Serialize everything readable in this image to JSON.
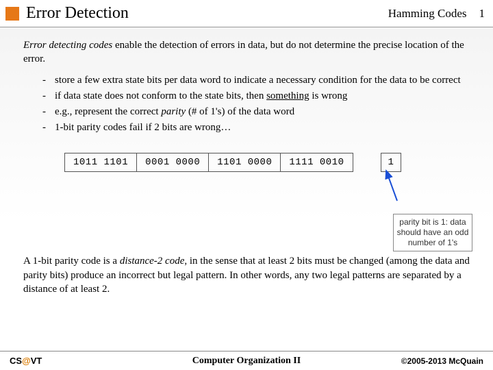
{
  "header": {
    "title": "Error Detection",
    "right": "Hamming Codes",
    "page": "1"
  },
  "intro": {
    "lead": "Error detecting codes",
    "rest": " enable the detection of errors in data, but do not determine the precise location of the error."
  },
  "bullets": [
    {
      "parts": [
        {
          "t": "store a few extra state bits per data word to indicate a necessary condition for the data to be correct"
        }
      ]
    },
    {
      "parts": [
        {
          "t": "if data state does not conform to the state bits, then "
        },
        {
          "t": "something",
          "u": true
        },
        {
          "t": " is wrong"
        }
      ]
    },
    {
      "parts": [
        {
          "t": "e.g., represent the correct "
        },
        {
          "t": "parity",
          "i": true
        },
        {
          "t": " (# of 1's) of the data word"
        }
      ]
    },
    {
      "parts": [
        {
          "t": "1-bit parity codes fail if 2 bits are wrong…"
        }
      ]
    }
  ],
  "data_cells": [
    "1011 1101",
    "0001 0000",
    "1101 0000",
    "1111 0010"
  ],
  "parity_bit": "1",
  "callout": "parity bit is 1: data should have an odd number of 1's",
  "para2": {
    "a": "A 1-bit parity code is a ",
    "b": "distance-2 code",
    "c": ", in the sense that at least 2 bits must be changed (among the data and parity bits) produce an incorrect but legal pattern.  In other words, any two legal patterns are separated by a distance of at least 2."
  },
  "footer": {
    "left_a": "CS",
    "left_at": "@",
    "left_b": "VT",
    "center": "Computer Organization II",
    "right": "©2005-2013 McQuain"
  }
}
